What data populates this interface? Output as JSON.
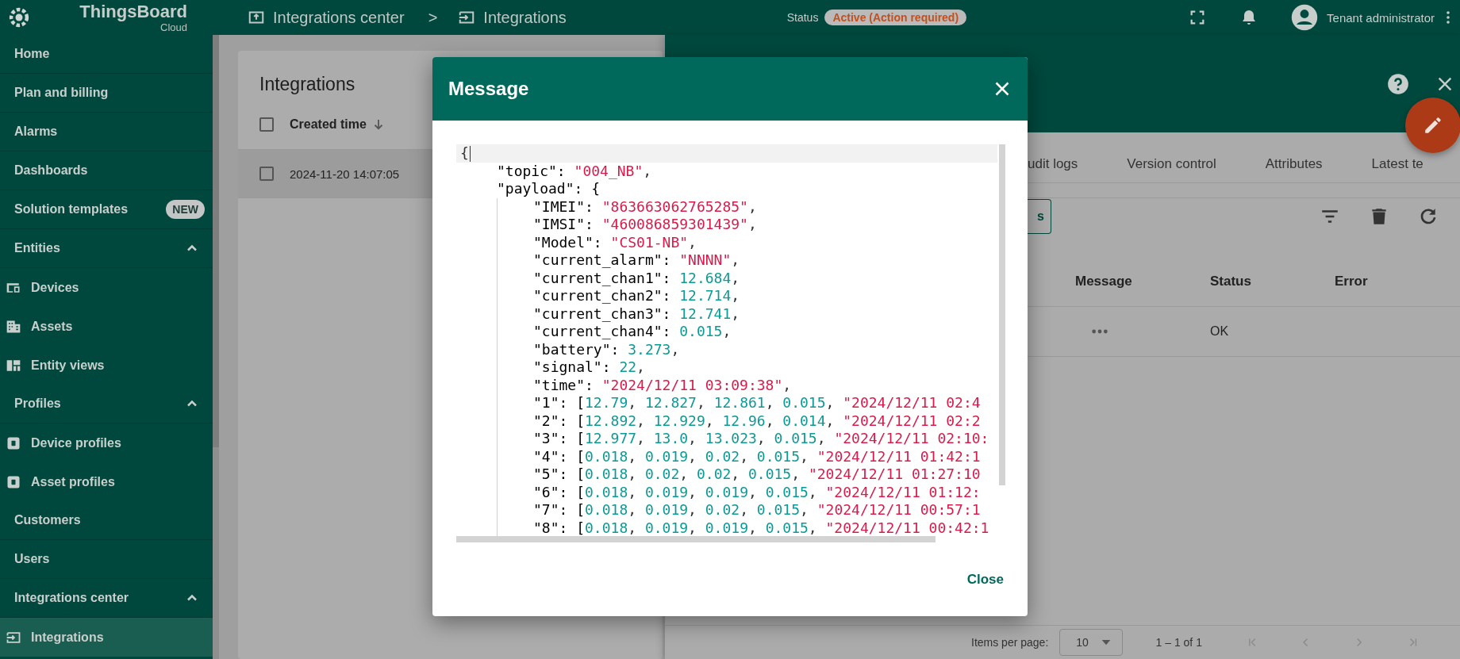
{
  "header": {
    "logo": "ThingsBoard",
    "logo_sub": "Cloud",
    "breadcrumbs": [
      {
        "label": "Integrations center"
      },
      {
        "label": "Integrations"
      }
    ],
    "separator": ">",
    "status_label": "Status",
    "status": "Active (Action required)",
    "user_role": "Tenant administrator"
  },
  "sidebar": {
    "items": [
      {
        "label": "Home",
        "kind": "link",
        "selected": false
      },
      {
        "label": "Plan and billing",
        "kind": "link",
        "selected": false
      },
      {
        "label": "Alarms",
        "kind": "link",
        "selected": false
      },
      {
        "label": "Dashboards",
        "kind": "link",
        "selected": false
      },
      {
        "label": "Solution templates",
        "kind": "link",
        "selected": false,
        "badge": "NEW"
      },
      {
        "label": "Entities",
        "kind": "section",
        "expanded": true,
        "children": [
          {
            "label": "Devices",
            "selected": false
          },
          {
            "label": "Assets",
            "selected": false
          },
          {
            "label": "Entity views",
            "selected": false
          }
        ]
      },
      {
        "label": "Profiles",
        "kind": "section",
        "expanded": true,
        "children": [
          {
            "label": "Device profiles",
            "selected": false
          },
          {
            "label": "Asset profiles",
            "selected": false
          }
        ]
      },
      {
        "label": "Customers",
        "kind": "link",
        "selected": false
      },
      {
        "label": "Users",
        "kind": "link",
        "selected": false
      },
      {
        "label": "Integrations center",
        "kind": "section",
        "expanded": true,
        "children": [
          {
            "label": "Integrations",
            "selected": true
          }
        ]
      }
    ]
  },
  "left_panel": {
    "title": "Integrations",
    "select_all_checked": false,
    "columns": [
      {
        "label": "Created time"
      }
    ],
    "rows": [
      {
        "created_time": "2024-11-20 14:07:05",
        "checked": false,
        "selected": true
      }
    ]
  },
  "right_panel": {
    "tabs": [
      {
        "label": "udit logs",
        "selected": false
      },
      {
        "label": "Version control",
        "selected": false
      },
      {
        "label": "Attributes",
        "selected": false
      },
      {
        "label": "Latest te",
        "selected": false
      }
    ],
    "button": "s",
    "columns": [
      "Message",
      "Status",
      "Error"
    ],
    "rows": [
      {
        "status": "OK"
      }
    ],
    "pagination": {
      "label": "Items per page:",
      "page_size": "10",
      "range": "1 – 1 of 1"
    }
  },
  "dialog": {
    "title": "Message",
    "close": "Close",
    "code": [
      {
        "active": true,
        "tokens": [
          {
            "kind": "punct",
            "text": "{"
          }
        ],
        "children": [
          {
            "tokens": [
              {
                "kind": "key",
                "text": "\"topic\": "
              },
              {
                "kind": "string",
                "text": "\"004_NB\""
              },
              {
                "kind": "punct",
                "text": ","
              }
            ]
          },
          {
            "tokens": [
              {
                "kind": "key",
                "text": "\"payload\": {"
              }
            ],
            "children": [
              {
                "tokens": [
                  {
                    "kind": "key",
                    "text": "\"IMEI\": "
                  },
                  {
                    "kind": "string",
                    "text": "\"863663062765285\""
                  },
                  {
                    "kind": "punct",
                    "text": ","
                  }
                ]
              },
              {
                "tokens": [
                  {
                    "kind": "key",
                    "text": "\"IMSI\": "
                  },
                  {
                    "kind": "string",
                    "text": "\"460086859301439\""
                  },
                  {
                    "kind": "punct",
                    "text": ","
                  }
                ]
              },
              {
                "tokens": [
                  {
                    "kind": "key",
                    "text": "\"Model\": "
                  },
                  {
                    "kind": "string",
                    "text": "\"CS01-NB\""
                  },
                  {
                    "kind": "punct",
                    "text": ","
                  }
                ]
              },
              {
                "tokens": [
                  {
                    "kind": "key",
                    "text": "\"current_alarm\": "
                  },
                  {
                    "kind": "string",
                    "text": "\"NNNN\""
                  },
                  {
                    "kind": "punct",
                    "text": ","
                  }
                ]
              },
              {
                "tokens": [
                  {
                    "kind": "key",
                    "text": "\"current_chan1\": "
                  },
                  {
                    "kind": "number",
                    "text": "12.684"
                  },
                  {
                    "kind": "punct",
                    "text": ","
                  }
                ]
              },
              {
                "tokens": [
                  {
                    "kind": "key",
                    "text": "\"current_chan2\": "
                  },
                  {
                    "kind": "number",
                    "text": "12.714"
                  },
                  {
                    "kind": "punct",
                    "text": ","
                  }
                ]
              },
              {
                "tokens": [
                  {
                    "kind": "key",
                    "text": "\"current_chan3\": "
                  },
                  {
                    "kind": "number",
                    "text": "12.741"
                  },
                  {
                    "kind": "punct",
                    "text": ","
                  }
                ]
              },
              {
                "tokens": [
                  {
                    "kind": "key",
                    "text": "\"current_chan4\": "
                  },
                  {
                    "kind": "number",
                    "text": "0.015"
                  },
                  {
                    "kind": "punct",
                    "text": ","
                  }
                ]
              },
              {
                "tokens": [
                  {
                    "kind": "key",
                    "text": "\"battery\": "
                  },
                  {
                    "kind": "number",
                    "text": "3.273"
                  },
                  {
                    "kind": "punct",
                    "text": ","
                  }
                ]
              },
              {
                "tokens": [
                  {
                    "kind": "key",
                    "text": "\"signal\": "
                  },
                  {
                    "kind": "number",
                    "text": "22"
                  },
                  {
                    "kind": "punct",
                    "text": ","
                  }
                ]
              },
              {
                "tokens": [
                  {
                    "kind": "key",
                    "text": "\"time\": "
                  },
                  {
                    "kind": "string",
                    "text": "\"2024/12/11 03:09:38\""
                  },
                  {
                    "kind": "punct",
                    "text": ","
                  }
                ]
              },
              {
                "tokens": [
                  {
                    "kind": "key",
                    "text": "\"1\": ["
                  },
                  {
                    "kind": "number",
                    "text": "12.79"
                  },
                  {
                    "kind": "punct",
                    "text": ", "
                  },
                  {
                    "kind": "number",
                    "text": "12.827"
                  },
                  {
                    "kind": "punct",
                    "text": ", "
                  },
                  {
                    "kind": "number",
                    "text": "12.861"
                  },
                  {
                    "kind": "punct",
                    "text": ", "
                  },
                  {
                    "kind": "number",
                    "text": "0.015"
                  },
                  {
                    "kind": "punct",
                    "text": ", "
                  },
                  {
                    "kind": "string",
                    "text": "\"2024/12/11 02:4"
                  }
                ]
              },
              {
                "tokens": [
                  {
                    "kind": "key",
                    "text": "\"2\": ["
                  },
                  {
                    "kind": "number",
                    "text": "12.892"
                  },
                  {
                    "kind": "punct",
                    "text": ", "
                  },
                  {
                    "kind": "number",
                    "text": "12.929"
                  },
                  {
                    "kind": "punct",
                    "text": ", "
                  },
                  {
                    "kind": "number",
                    "text": "12.96"
                  },
                  {
                    "kind": "punct",
                    "text": ", "
                  },
                  {
                    "kind": "number",
                    "text": "0.014"
                  },
                  {
                    "kind": "punct",
                    "text": ", "
                  },
                  {
                    "kind": "string",
                    "text": "\"2024/12/11 02:2"
                  }
                ]
              },
              {
                "tokens": [
                  {
                    "kind": "key",
                    "text": "\"3\": ["
                  },
                  {
                    "kind": "number",
                    "text": "12.977"
                  },
                  {
                    "kind": "punct",
                    "text": ", "
                  },
                  {
                    "kind": "number",
                    "text": "13.0"
                  },
                  {
                    "kind": "punct",
                    "text": ", "
                  },
                  {
                    "kind": "number",
                    "text": "13.023"
                  },
                  {
                    "kind": "punct",
                    "text": ", "
                  },
                  {
                    "kind": "number",
                    "text": "0.015"
                  },
                  {
                    "kind": "punct",
                    "text": ", "
                  },
                  {
                    "kind": "string",
                    "text": "\"2024/12/11 02:10:"
                  }
                ]
              },
              {
                "tokens": [
                  {
                    "kind": "key",
                    "text": "\"4\": ["
                  },
                  {
                    "kind": "number",
                    "text": "0.018"
                  },
                  {
                    "kind": "punct",
                    "text": ", "
                  },
                  {
                    "kind": "number",
                    "text": "0.019"
                  },
                  {
                    "kind": "punct",
                    "text": ", "
                  },
                  {
                    "kind": "number",
                    "text": "0.02"
                  },
                  {
                    "kind": "punct",
                    "text": ", "
                  },
                  {
                    "kind": "number",
                    "text": "0.015"
                  },
                  {
                    "kind": "punct",
                    "text": ", "
                  },
                  {
                    "kind": "string",
                    "text": "\"2024/12/11 01:42:1"
                  }
                ]
              },
              {
                "tokens": [
                  {
                    "kind": "key",
                    "text": "\"5\": ["
                  },
                  {
                    "kind": "number",
                    "text": "0.018"
                  },
                  {
                    "kind": "punct",
                    "text": ", "
                  },
                  {
                    "kind": "number",
                    "text": "0.02"
                  },
                  {
                    "kind": "punct",
                    "text": ", "
                  },
                  {
                    "kind": "number",
                    "text": "0.02"
                  },
                  {
                    "kind": "punct",
                    "text": ", "
                  },
                  {
                    "kind": "number",
                    "text": "0.015"
                  },
                  {
                    "kind": "punct",
                    "text": ", "
                  },
                  {
                    "kind": "string",
                    "text": "\"2024/12/11 01:27:10"
                  }
                ]
              },
              {
                "tokens": [
                  {
                    "kind": "key",
                    "text": "\"6\": ["
                  },
                  {
                    "kind": "number",
                    "text": "0.018"
                  },
                  {
                    "kind": "punct",
                    "text": ", "
                  },
                  {
                    "kind": "number",
                    "text": "0.019"
                  },
                  {
                    "kind": "punct",
                    "text": ", "
                  },
                  {
                    "kind": "number",
                    "text": "0.019"
                  },
                  {
                    "kind": "punct",
                    "text": ", "
                  },
                  {
                    "kind": "number",
                    "text": "0.015"
                  },
                  {
                    "kind": "punct",
                    "text": ", "
                  },
                  {
                    "kind": "string",
                    "text": "\"2024/12/11 01:12:"
                  }
                ]
              },
              {
                "tokens": [
                  {
                    "kind": "key",
                    "text": "\"7\": ["
                  },
                  {
                    "kind": "number",
                    "text": "0.018"
                  },
                  {
                    "kind": "punct",
                    "text": ", "
                  },
                  {
                    "kind": "number",
                    "text": "0.019"
                  },
                  {
                    "kind": "punct",
                    "text": ", "
                  },
                  {
                    "kind": "number",
                    "text": "0.02"
                  },
                  {
                    "kind": "punct",
                    "text": ", "
                  },
                  {
                    "kind": "number",
                    "text": "0.015"
                  },
                  {
                    "kind": "punct",
                    "text": ", "
                  },
                  {
                    "kind": "string",
                    "text": "\"2024/12/11 00:57:1"
                  }
                ]
              },
              {
                "tokens": [
                  {
                    "kind": "key",
                    "text": "\"8\": ["
                  },
                  {
                    "kind": "number",
                    "text": "0.018"
                  },
                  {
                    "kind": "punct",
                    "text": ", "
                  },
                  {
                    "kind": "number",
                    "text": "0.019"
                  },
                  {
                    "kind": "punct",
                    "text": ", "
                  },
                  {
                    "kind": "number",
                    "text": "0.019"
                  },
                  {
                    "kind": "punct",
                    "text": ", "
                  },
                  {
                    "kind": "number",
                    "text": "0.015"
                  },
                  {
                    "kind": "punct",
                    "text": ", "
                  },
                  {
                    "kind": "string",
                    "text": "\"2024/12/11 00:42:1"
                  }
                ]
              }
            ]
          }
        ]
      }
    ]
  }
}
